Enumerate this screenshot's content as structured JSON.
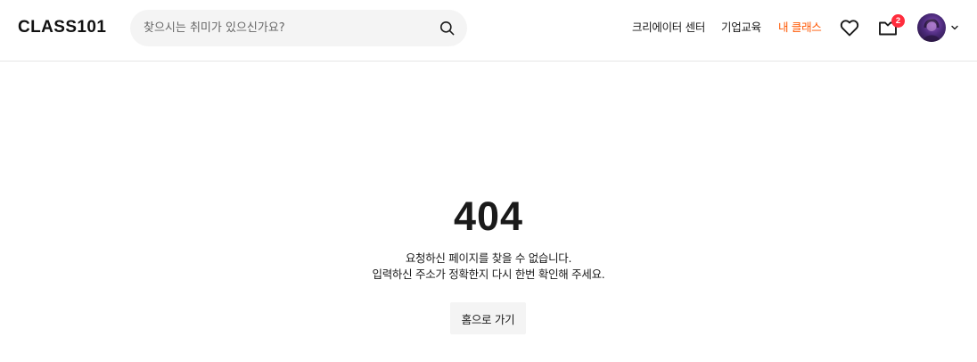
{
  "header": {
    "logo": "CLASS101",
    "search": {
      "placeholder": "찾으시는 취미가 있으신가요?",
      "value": ""
    },
    "nav": {
      "creator_center": "크리에이터 센터",
      "corporate_education": "기업교육",
      "my_class": "내 클래스"
    },
    "notification_count": "2",
    "accent_color": "#ff5600",
    "badge_color": "#ff2d3d"
  },
  "error": {
    "code": "404",
    "message_line1": "요청하신 페이지를 찾을 수 없습니다.",
    "message_line2": "입력하신 주소가 정확한지 다시 한번 확인해 주세요.",
    "home_button": "홈으로 가기"
  }
}
